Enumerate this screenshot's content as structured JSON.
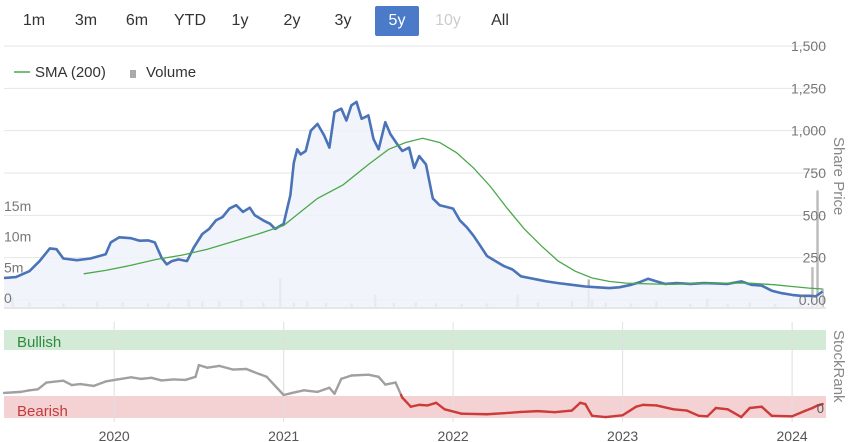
{
  "range_buttons": [
    {
      "label": "1m",
      "state": "normal"
    },
    {
      "label": "3m",
      "state": "normal"
    },
    {
      "label": "6m",
      "state": "normal"
    },
    {
      "label": "YTD",
      "state": "normal"
    },
    {
      "label": "1y",
      "state": "normal"
    },
    {
      "label": "2y",
      "state": "normal"
    },
    {
      "label": "3y",
      "state": "normal"
    },
    {
      "label": "5y",
      "state": "active"
    },
    {
      "label": "10y",
      "state": "disabled"
    },
    {
      "label": "All",
      "state": "normal"
    }
  ],
  "chart_data": {
    "type": "line",
    "legend": {
      "placement": "top-left",
      "entries": [
        "SMA (200)",
        "Volume"
      ]
    },
    "x_axis": {
      "ticks": [
        "2020",
        "2021",
        "2022",
        "2023",
        "2024"
      ],
      "range": [
        2019.35,
        2024.2
      ]
    },
    "price_axis": {
      "label": "Share Price",
      "range": [
        0,
        1500
      ],
      "ticks": [
        "0.00",
        "250",
        "500",
        "750",
        "1,000",
        "1,250",
        "1,500"
      ]
    },
    "volume_axis": {
      "range": [
        0,
        22.5
      ],
      "ticks": [
        "0",
        "5m",
        "10m",
        "15m"
      ]
    },
    "stockrank": {
      "label": "StockRank",
      "zones": [
        "Bullish",
        "Bearish"
      ],
      "tick": "0"
    },
    "colors": {
      "price": "#4a73b8",
      "sma": "#4aa84a",
      "volume": "#bbbbbb",
      "rank_good": "#a0a0a0",
      "rank_bad": "#cc3a3a",
      "bullish_band": "#d3ead7",
      "bearish_band": "#f4d2d3"
    },
    "series": [
      {
        "name": "Share Price",
        "points": [
          [
            2019.35,
            130
          ],
          [
            2019.42,
            135
          ],
          [
            2019.5,
            170
          ],
          [
            2019.56,
            230
          ],
          [
            2019.62,
            305
          ],
          [
            2019.66,
            300
          ],
          [
            2019.7,
            245
          ],
          [
            2019.78,
            235
          ],
          [
            2019.86,
            245
          ],
          [
            2019.95,
            270
          ],
          [
            2019.98,
            340
          ],
          [
            2020.03,
            370
          ],
          [
            2020.1,
            365
          ],
          [
            2020.15,
            350
          ],
          [
            2020.2,
            352
          ],
          [
            2020.24,
            340
          ],
          [
            2020.28,
            250
          ],
          [
            2020.31,
            210
          ],
          [
            2020.34,
            230
          ],
          [
            2020.38,
            240
          ],
          [
            2020.43,
            230
          ],
          [
            2020.47,
            310
          ],
          [
            2020.52,
            390
          ],
          [
            2020.56,
            420
          ],
          [
            2020.6,
            470
          ],
          [
            2020.64,
            490
          ],
          [
            2020.68,
            540
          ],
          [
            2020.72,
            560
          ],
          [
            2020.76,
            520
          ],
          [
            2020.8,
            545
          ],
          [
            2020.83,
            500
          ],
          [
            2020.88,
            470
          ],
          [
            2020.92,
            450
          ],
          [
            2020.95,
            420
          ],
          [
            2021.0,
            450
          ],
          [
            2021.04,
            620
          ],
          [
            2021.06,
            810
          ],
          [
            2021.08,
            890
          ],
          [
            2021.1,
            860
          ],
          [
            2021.13,
            880
          ],
          [
            2021.16,
            1000
          ],
          [
            2021.2,
            1040
          ],
          [
            2021.24,
            970
          ],
          [
            2021.27,
            900
          ],
          [
            2021.3,
            1110
          ],
          [
            2021.34,
            1130
          ],
          [
            2021.37,
            1060
          ],
          [
            2021.4,
            1150
          ],
          [
            2021.43,
            1170
          ],
          [
            2021.46,
            1070
          ],
          [
            2021.5,
            1090
          ],
          [
            2021.53,
            950
          ],
          [
            2021.56,
            890
          ],
          [
            2021.6,
            1050
          ],
          [
            2021.63,
            980
          ],
          [
            2021.67,
            920
          ],
          [
            2021.7,
            880
          ],
          [
            2021.74,
            900
          ],
          [
            2021.77,
            780
          ],
          [
            2021.8,
            850
          ],
          [
            2021.84,
            800
          ],
          [
            2021.88,
            600
          ],
          [
            2021.92,
            560
          ],
          [
            2021.96,
            550
          ],
          [
            2022.0,
            540
          ],
          [
            2022.04,
            470
          ],
          [
            2022.08,
            430
          ],
          [
            2022.12,
            380
          ],
          [
            2022.16,
            320
          ],
          [
            2022.2,
            260
          ],
          [
            2022.25,
            230
          ],
          [
            2022.3,
            200
          ],
          [
            2022.35,
            180
          ],
          [
            2022.4,
            140
          ],
          [
            2022.45,
            130
          ],
          [
            2022.5,
            120
          ],
          [
            2022.55,
            110
          ],
          [
            2022.62,
            100
          ],
          [
            2022.7,
            90
          ],
          [
            2022.78,
            80
          ],
          [
            2022.85,
            75
          ],
          [
            2022.92,
            70
          ],
          [
            2022.98,
            75
          ],
          [
            2023.05,
            90
          ],
          [
            2023.1,
            105
          ],
          [
            2023.15,
            125
          ],
          [
            2023.2,
            110
          ],
          [
            2023.25,
            95
          ],
          [
            2023.32,
            100
          ],
          [
            2023.4,
            95
          ],
          [
            2023.48,
            100
          ],
          [
            2023.55,
            98
          ],
          [
            2023.62,
            95
          ],
          [
            2023.7,
            110
          ],
          [
            2023.76,
            90
          ],
          [
            2023.82,
            85
          ],
          [
            2023.88,
            55
          ],
          [
            2023.94,
            40
          ],
          [
            2024.0,
            30
          ],
          [
            2024.05,
            25
          ],
          [
            2024.1,
            25
          ],
          [
            2024.14,
            22
          ],
          [
            2024.18,
            50
          ]
        ]
      },
      {
        "name": "SMA (200)",
        "points": [
          [
            2019.82,
            155
          ],
          [
            2019.95,
            175
          ],
          [
            2020.1,
            205
          ],
          [
            2020.25,
            240
          ],
          [
            2020.4,
            265
          ],
          [
            2020.55,
            300
          ],
          [
            2020.7,
            345
          ],
          [
            2020.85,
            390
          ],
          [
            2021.0,
            440
          ],
          [
            2021.1,
            520
          ],
          [
            2021.2,
            600
          ],
          [
            2021.35,
            680
          ],
          [
            2021.5,
            800
          ],
          [
            2021.62,
            890
          ],
          [
            2021.72,
            930
          ],
          [
            2021.82,
            955
          ],
          [
            2021.92,
            930
          ],
          [
            2022.02,
            870
          ],
          [
            2022.12,
            780
          ],
          [
            2022.22,
            670
          ],
          [
            2022.32,
            540
          ],
          [
            2022.42,
            420
          ],
          [
            2022.52,
            320
          ],
          [
            2022.62,
            230
          ],
          [
            2022.72,
            170
          ],
          [
            2022.82,
            130
          ],
          [
            2022.92,
            110
          ],
          [
            2023.02,
            100
          ],
          [
            2023.15,
            95
          ],
          [
            2023.3,
            92
          ],
          [
            2023.45,
            98
          ],
          [
            2023.6,
            100
          ],
          [
            2023.75,
            100
          ],
          [
            2023.9,
            90
          ],
          [
            2024.0,
            80
          ],
          [
            2024.1,
            70
          ],
          [
            2024.18,
            65
          ]
        ]
      },
      {
        "name": "Volume",
        "points": [
          [
            2019.4,
            1.6
          ],
          [
            2019.5,
            0.8
          ],
          [
            2019.7,
            0.6
          ],
          [
            2019.9,
            0.9
          ],
          [
            2020.05,
            0.8
          ],
          [
            2020.2,
            0.6
          ],
          [
            2020.32,
            0.7
          ],
          [
            2020.44,
            1.2
          ],
          [
            2020.52,
            0.9
          ],
          [
            2020.62,
            1.0
          ],
          [
            2020.75,
            1.1
          ],
          [
            2020.88,
            0.8
          ],
          [
            2020.98,
            4.7
          ],
          [
            2021.06,
            0.8
          ],
          [
            2021.14,
            0.9
          ],
          [
            2021.25,
            0.7
          ],
          [
            2021.4,
            0.6
          ],
          [
            2021.54,
            2.0
          ],
          [
            2021.65,
            0.7
          ],
          [
            2021.78,
            0.8
          ],
          [
            2021.9,
            0.6
          ],
          [
            2022.05,
            0.5
          ],
          [
            2022.2,
            0.6
          ],
          [
            2022.38,
            2.0
          ],
          [
            2022.5,
            0.8
          ],
          [
            2022.7,
            1.0
          ],
          [
            2022.82,
            1.2
          ],
          [
            2022.8,
            4.5
          ],
          [
            2022.9,
            0.8
          ],
          [
            2023.05,
            0.6
          ],
          [
            2023.2,
            0.9
          ],
          [
            2023.4,
            0.5
          ],
          [
            2023.5,
            1.4
          ],
          [
            2023.62,
            0.5
          ],
          [
            2023.75,
            0.8
          ],
          [
            2023.9,
            0.5
          ],
          [
            2024.05,
            0.8
          ],
          [
            2024.12,
            6.5
          ],
          [
            2024.15,
            19.0
          ],
          [
            2024.18,
            3.0
          ]
        ]
      },
      {
        "name": "StockRank",
        "points": [
          [
            2019.35,
            0.08
          ],
          [
            2019.45,
            0.12
          ],
          [
            2019.5,
            0.18
          ],
          [
            2019.55,
            0.22
          ],
          [
            2019.6,
            0.48
          ],
          [
            2019.7,
            0.55
          ],
          [
            2019.75,
            0.38
          ],
          [
            2019.8,
            0.42
          ],
          [
            2019.88,
            0.35
          ],
          [
            2019.95,
            0.52
          ],
          [
            2020.02,
            0.6
          ],
          [
            2020.1,
            0.68
          ],
          [
            2020.16,
            0.62
          ],
          [
            2020.22,
            0.66
          ],
          [
            2020.28,
            0.56
          ],
          [
            2020.35,
            0.6
          ],
          [
            2020.42,
            0.58
          ],
          [
            2020.48,
            0.7
          ],
          [
            2020.5,
            1.15
          ],
          [
            2020.55,
            1.05
          ],
          [
            2020.62,
            1.12
          ],
          [
            2020.7,
            0.98
          ],
          [
            2020.78,
            1.0
          ],
          [
            2020.85,
            0.82
          ],
          [
            2020.9,
            0.7
          ],
          [
            2020.95,
            0.35
          ],
          [
            2021.0,
            0.0
          ],
          [
            2021.05,
            0.08
          ],
          [
            2021.12,
            0.18
          ],
          [
            2021.2,
            0.12
          ],
          [
            2021.27,
            0.28
          ],
          [
            2021.3,
            0.05
          ],
          [
            2021.34,
            0.62
          ],
          [
            2021.4,
            0.75
          ],
          [
            2021.5,
            0.78
          ],
          [
            2021.56,
            0.7
          ],
          [
            2021.6,
            0.4
          ],
          [
            2021.66,
            0.48
          ],
          [
            2021.7,
            -0.1
          ],
          [
            2021.75,
            -0.45
          ],
          [
            2021.8,
            -0.38
          ],
          [
            2021.85,
            -0.4
          ],
          [
            2021.9,
            -0.3
          ],
          [
            2021.95,
            -0.55
          ],
          [
            2022.05,
            -0.72
          ],
          [
            2022.2,
            -0.74
          ],
          [
            2022.3,
            -0.7
          ],
          [
            2022.4,
            -0.65
          ],
          [
            2022.5,
            -0.62
          ],
          [
            2022.6,
            -0.66
          ],
          [
            2022.7,
            -0.6
          ],
          [
            2022.75,
            -0.3
          ],
          [
            2022.78,
            -0.35
          ],
          [
            2022.82,
            -0.8
          ],
          [
            2022.9,
            -0.85
          ],
          [
            2023.0,
            -0.78
          ],
          [
            2023.08,
            -0.45
          ],
          [
            2023.12,
            -0.38
          ],
          [
            2023.2,
            -0.4
          ],
          [
            2023.3,
            -0.55
          ],
          [
            2023.38,
            -0.6
          ],
          [
            2023.45,
            -0.8
          ],
          [
            2023.5,
            -0.82
          ],
          [
            2023.55,
            -0.5
          ],
          [
            2023.62,
            -0.55
          ],
          [
            2023.7,
            -0.85
          ],
          [
            2023.75,
            -0.5
          ],
          [
            2023.82,
            -0.45
          ],
          [
            2023.88,
            -0.8
          ],
          [
            2024.0,
            -0.82
          ],
          [
            2024.08,
            -0.6
          ],
          [
            2024.12,
            -0.5
          ],
          [
            2024.15,
            -0.4
          ],
          [
            2024.18,
            -0.35
          ]
        ]
      }
    ]
  }
}
